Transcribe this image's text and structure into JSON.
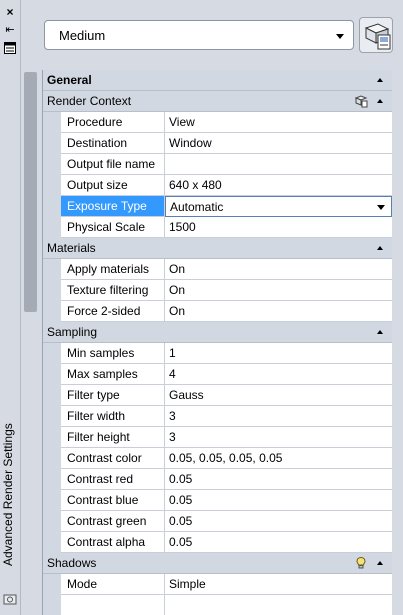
{
  "palette": {
    "title": "Advanced Render Settings",
    "preset": {
      "value": "Medium"
    }
  },
  "categories": [
    {
      "label": "General",
      "kind": "top",
      "rows": []
    },
    {
      "label": "Render Context",
      "kind": "sub",
      "icon": "render-context-icon",
      "rows": [
        {
          "name": "Procedure",
          "value": "View"
        },
        {
          "name": "Destination",
          "value": "Window"
        },
        {
          "name": "Output file name",
          "value": ""
        },
        {
          "name": "Output size",
          "value": "640 x 480"
        },
        {
          "name": "Exposure Type",
          "value": "Automatic",
          "selected": true
        },
        {
          "name": "Physical Scale",
          "value": "1500"
        }
      ]
    },
    {
      "label": "Materials",
      "kind": "sub",
      "rows": [
        {
          "name": "Apply materials",
          "value": "On"
        },
        {
          "name": "Texture filtering",
          "value": "On"
        },
        {
          "name": "Force 2-sided",
          "value": "On"
        }
      ]
    },
    {
      "label": "Sampling",
      "kind": "sub",
      "rows": [
        {
          "name": "Min samples",
          "value": "1"
        },
        {
          "name": "Max samples",
          "value": "4"
        },
        {
          "name": "Filter type",
          "value": "Gauss"
        },
        {
          "name": "Filter width",
          "value": "3"
        },
        {
          "name": "Filter height",
          "value": "3"
        },
        {
          "name": "Contrast color",
          "value": "0.05, 0.05, 0.05, 0.05"
        },
        {
          "name": "Contrast red",
          "value": "0.05"
        },
        {
          "name": "Contrast blue",
          "value": "0.05"
        },
        {
          "name": "Contrast green",
          "value": "0.05"
        },
        {
          "name": "Contrast alpha",
          "value": "0.05"
        }
      ]
    },
    {
      "label": "Shadows",
      "kind": "sub",
      "icon": "lightbulb-icon",
      "rows": [
        {
          "name": "Mode",
          "value": "Simple"
        }
      ]
    }
  ],
  "colors": {
    "selection": "#3399ff",
    "panel": "#d6dbe3",
    "category": "#d2d8e1"
  },
  "icons": [
    "close-icon",
    "auto-hide-icon",
    "properties-icon",
    "render-icon",
    "render-context-icon",
    "lightbulb-icon"
  ]
}
